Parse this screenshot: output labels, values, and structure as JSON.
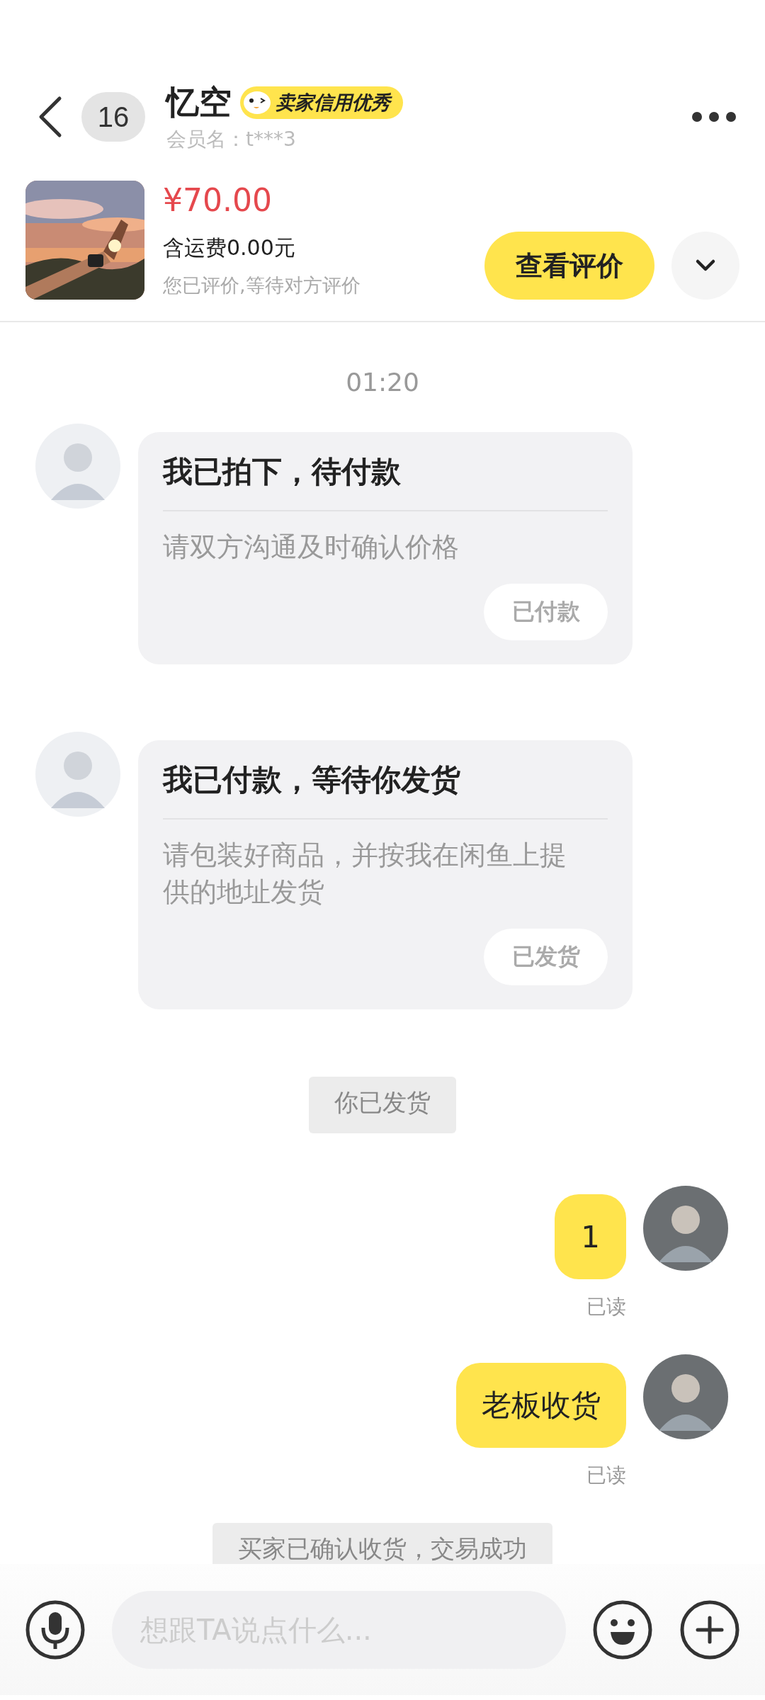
{
  "header": {
    "back_count": "16",
    "name": "忆空",
    "badge": "卖家信用优秀",
    "member": "会员名：t***3"
  },
  "product": {
    "price": "¥70.00",
    "shipping": "含运费0.00元",
    "status": "您已评价,等待对方评价",
    "action": "查看评价"
  },
  "messages": [
    {
      "kind": "time",
      "text": "01:20"
    },
    {
      "kind": "card",
      "title": "我已拍下，待付款",
      "body": "请双方沟通及时确认价格",
      "button": "已付款"
    },
    {
      "kind": "card",
      "title": "我已付款，等待你发货",
      "body": "请包装好商品，并按我在闲鱼上提供的地址发货",
      "button": "已发货"
    },
    {
      "kind": "system",
      "text": "你已发货"
    },
    {
      "kind": "bubble",
      "text": "1",
      "status": "已读"
    },
    {
      "kind": "bubble",
      "text": "老板收货",
      "status": "已读"
    },
    {
      "kind": "system",
      "text": "买家已确认收货，交易成功"
    }
  ],
  "composer": {
    "placeholder": "想跟TA说点什么..."
  }
}
